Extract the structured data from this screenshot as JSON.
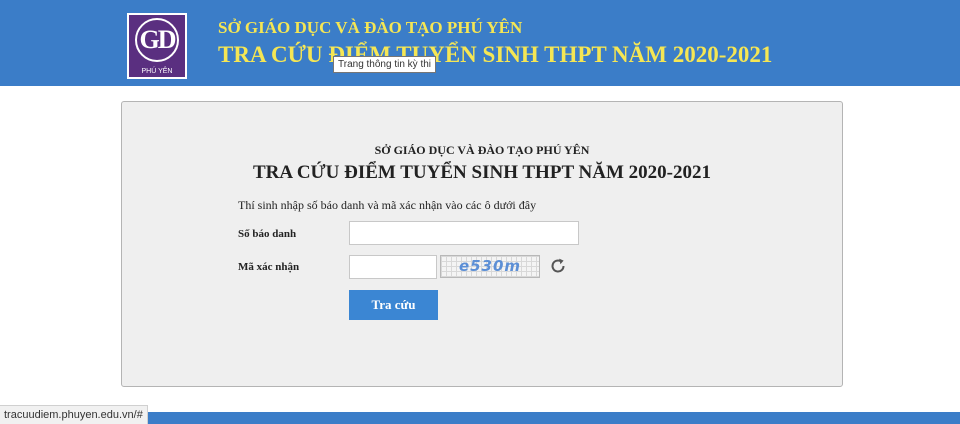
{
  "header": {
    "logo_letters": "GD",
    "logo_subtitle": "PHÚ YÊN",
    "line1": "SỞ GIÁO DỤC VÀ ĐÀO TẠO PHÚ YÊN",
    "line2": "TRA CỨU ĐIỂM TUYỂN SINH THPT NĂM 2020-2021",
    "background_color": "#3b7dc8",
    "text_color": "#f5e654"
  },
  "tooltip": {
    "text": "Trang thông tin kỳ thi"
  },
  "form": {
    "line1": "SỞ GIÁO DỤC VÀ ĐÀO TẠO PHÚ YÊN",
    "line2": "TRA CỨU ĐIỂM TUYỂN SINH THPT NĂM 2020-2021",
    "instruction": "Thí sinh nhập số báo danh và mã xác nhận vào các ô dưới đây",
    "sbd_label": "Số báo danh",
    "sbd_value": "",
    "captcha_label": "Mã xác nhận",
    "captcha_value": "",
    "captcha_text": "e530m",
    "refresh_icon": "refresh-icon",
    "submit_label": "Tra cứu",
    "button_color": "#3b86d3"
  },
  "status_bar": {
    "url": "tracuudiem.phuyen.edu.vn/#"
  }
}
